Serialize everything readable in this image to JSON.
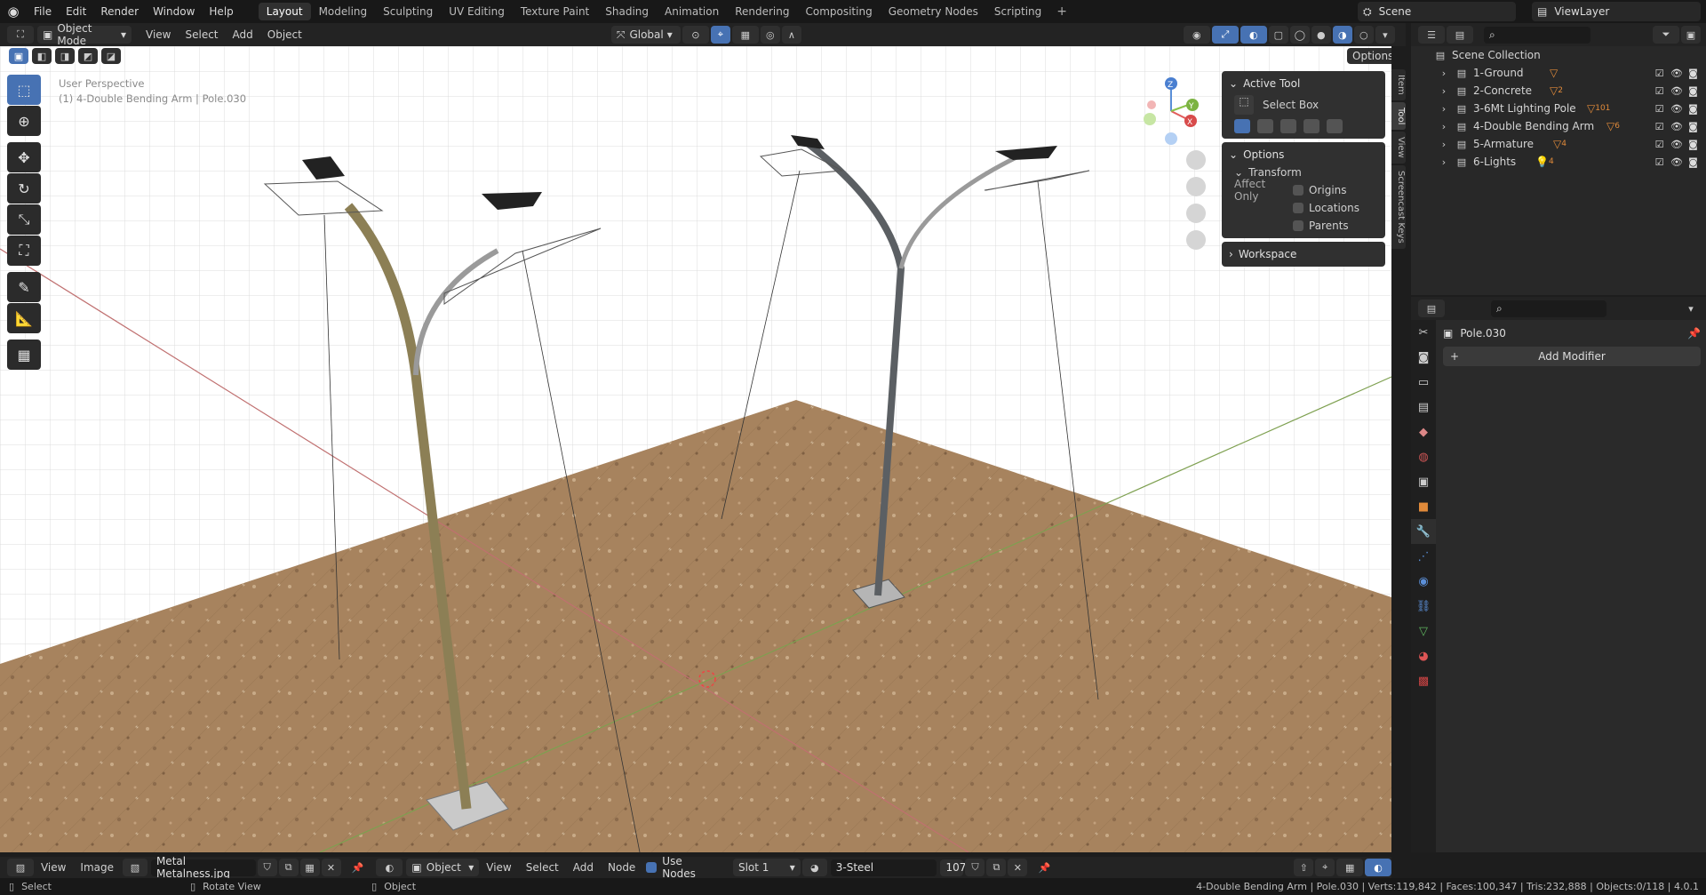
{
  "topbar": {
    "menus": [
      "File",
      "Edit",
      "Render",
      "Window",
      "Help"
    ],
    "workspaces": [
      "Layout",
      "Modeling",
      "Sculpting",
      "UV Editing",
      "Texture Paint",
      "Shading",
      "Animation",
      "Rendering",
      "Compositing",
      "Geometry Nodes",
      "Scripting"
    ],
    "active_workspace": "Layout",
    "scene": "Scene",
    "view_layer": "ViewLayer"
  },
  "viewport_header": {
    "mode": "Object Mode",
    "menus": [
      "View",
      "Select",
      "Add",
      "Object"
    ],
    "orientation": "Global",
    "options": "Options"
  },
  "viewport": {
    "perspective": "User Perspective",
    "active": "(1) 4-Double Bending Arm | Pole.030"
  },
  "npanel": {
    "active_tool": "Active Tool",
    "tool_name": "Select Box",
    "options": "Options",
    "transform": "Transform",
    "affect_only": "Affect Only",
    "origins": "Origins",
    "locations": "Locations",
    "parents": "Parents",
    "workspace": "Workspace",
    "tabs": [
      "Item",
      "Tool",
      "View",
      "Screencast Keys"
    ]
  },
  "outliner": {
    "root": "Scene Collection",
    "items": [
      {
        "name": "1-Ground",
        "badge": ""
      },
      {
        "name": "2-Concrete",
        "badge": "2"
      },
      {
        "name": "3-6Mt Lighting Pole",
        "badge": "101"
      },
      {
        "name": "4-Double Bending Arm",
        "badge": "6"
      },
      {
        "name": "5-Armature",
        "badge": "4"
      },
      {
        "name": "6-Lights",
        "badge": "4"
      }
    ]
  },
  "properties": {
    "object": "Pole.030",
    "add_modifier": "Add Modifier"
  },
  "bottom_header": {
    "view": "View",
    "image": "Image",
    "image_name": "Metal Metalness.jpg",
    "object": "Object",
    "menus": [
      "View",
      "Select",
      "Add",
      "Node"
    ],
    "use_nodes": "Use Nodes",
    "slot": "Slot 1",
    "material": "3-Steel",
    "users": "107"
  },
  "status": {
    "select": "Select",
    "rotate": "Rotate View",
    "object": "Object",
    "stats": "4-Double Bending Arm | Pole.030 | Verts:119,842 | Faces:100,347 | Tris:232,888 | Objects:0/118 | 4.0.1"
  },
  "colors": {
    "accent": "#4772b3",
    "ground": "#a7835e",
    "collection_icon": "#e08a3a"
  }
}
